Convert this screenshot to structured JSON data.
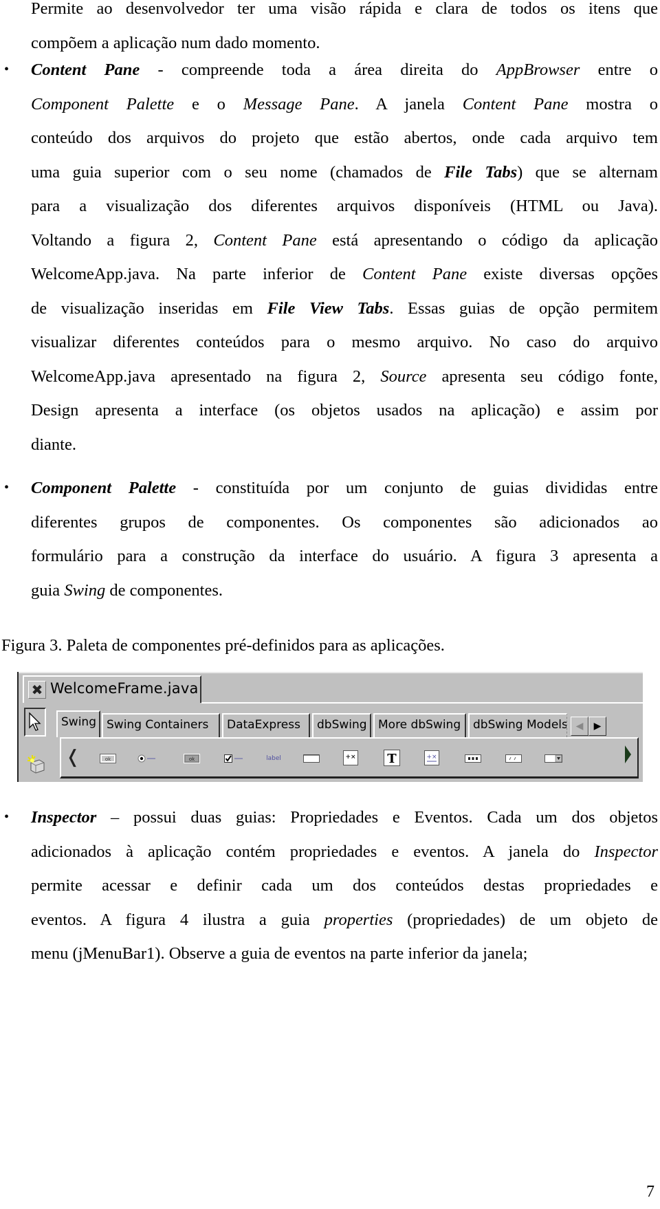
{
  "intro_paragraph": {
    "lines": [
      "Permite ao desenvolvedor ter uma visão rápida e clara de todos os itens que",
      "compõem a aplicação num dado momento."
    ]
  },
  "content_pane_item": {
    "bullet": "•",
    "term": "Content Pane",
    "lines": {
      "l1_after_term": " - compreende toda a área direita do ",
      "l1_appbrowser": "AppBrowser",
      "l1_end": " entre o",
      "l2_component_palette": "Component Palette",
      "l2_mid": " e o ",
      "l2_message_pane": "Message Pane",
      "l2_mid2": ". A janela ",
      "l2_content_pane": "Content Pane",
      "l2_end": " mostra o",
      "l3": "conteúdo dos arquivos do projeto que estão abertos, onde cada arquivo tem",
      "l4_start": "uma guia superior com o seu nome (chamados de ",
      "l4_file_tabs": "File Tabs",
      "l4_end": ") que se alternam",
      "l5": "para a visualização dos diferentes arquivos disponíveis (HTML ou Java).",
      "l6_start": "Voltando a figura 2, ",
      "l6_content_pane": "Content Pane",
      "l6_end": " está apresentando o código da aplicação",
      "l7_start": "WelcomeApp.java. Na parte inferior de ",
      "l7_content_pane": "Content Pane",
      "l7_end": " existe diversas opções",
      "l8_start": "de visualização inseridas em ",
      "l8_file_view_tabs": "File View Tabs",
      "l8_end": ". Essas guias de opção permitem",
      "l9": "visualizar diferentes conteúdos para o mesmo arquivo. No caso do arquivo",
      "l10_start": "WelcomeApp.java apresentado na figura 2, ",
      "l10_source": "Source",
      "l10_end": " apresenta seu código fonte,",
      "l11": "Design apresenta a interface (os objetos usados na aplicação) e assim por",
      "l12": "diante."
    }
  },
  "component_palette_item": {
    "bullet": "•",
    "term": "Component Palette",
    "lines": {
      "l1_after_term": " - constituída por um conjunto de guias divididas entre",
      "l2": "diferentes grupos de componentes. Os componentes são adicionados ao",
      "l3": "formulário para a construção da interface do usuário. A figura 3 apresenta a",
      "l4_start": "guia ",
      "l4_swing": "Swing",
      "l4_end": " de componentes."
    }
  },
  "figure_caption": "Figura 3. Paleta de componentes pré-definidos para as aplicações.",
  "palette": {
    "file_tab": {
      "close_icon": "✖",
      "name": "WelcomeFrame.java"
    },
    "tabs": [
      {
        "label": "Swing",
        "active": true
      },
      {
        "label": "Swing Containers",
        "active": false
      },
      {
        "label": "DataExpress",
        "active": false
      },
      {
        "label": "dbSwing",
        "active": false
      },
      {
        "label": "More dbSwing",
        "active": false
      },
      {
        "label": "dbSwing Models",
        "active": false
      }
    ],
    "tab_scroll_left": "◀",
    "tab_scroll_right": "▶",
    "component_scroll_left": "❬",
    "components": [
      "jbutton-icon",
      "jradiobutton-icon",
      "jtogglebutton-icon",
      "jcheckbox-icon",
      "jlabel-icon",
      "jtextfield-icon",
      "jtextarea-icon",
      "jtextpane-icon",
      "jeditorpane-icon",
      "jpasswordfield-icon-dots",
      "jpasswordfield-icon",
      "jcombobox-icon"
    ],
    "label_component_text": "label",
    "text_component_glyph": "T",
    "textarea_component_glyph": "+x",
    "colors": {
      "background": "#c0c0c0",
      "highlight": "#ffffff",
      "shadow": "#333333",
      "label_blue": "#5050a0"
    }
  },
  "inspector_item": {
    "bullet": "•",
    "term": "Inspector",
    "lines": {
      "l1_after_term": " – possui duas guias: Propriedades e Eventos. Cada um dos objetos",
      "l2_start": "adicionados à aplicação contém propriedades e eventos. A janela do ",
      "l2_inspector": "Inspector",
      "l3": "permite acessar e definir cada um dos conteúdos destas propriedades e",
      "l4_start": "eventos. A figura 4 ilustra a guia ",
      "l4_properties": "properties",
      "l4_end": " (propriedades) de um objeto de",
      "l5": "menu (jMenuBar1). Observe a guia de eventos na parte inferior da janela;"
    }
  },
  "page_number": "7"
}
